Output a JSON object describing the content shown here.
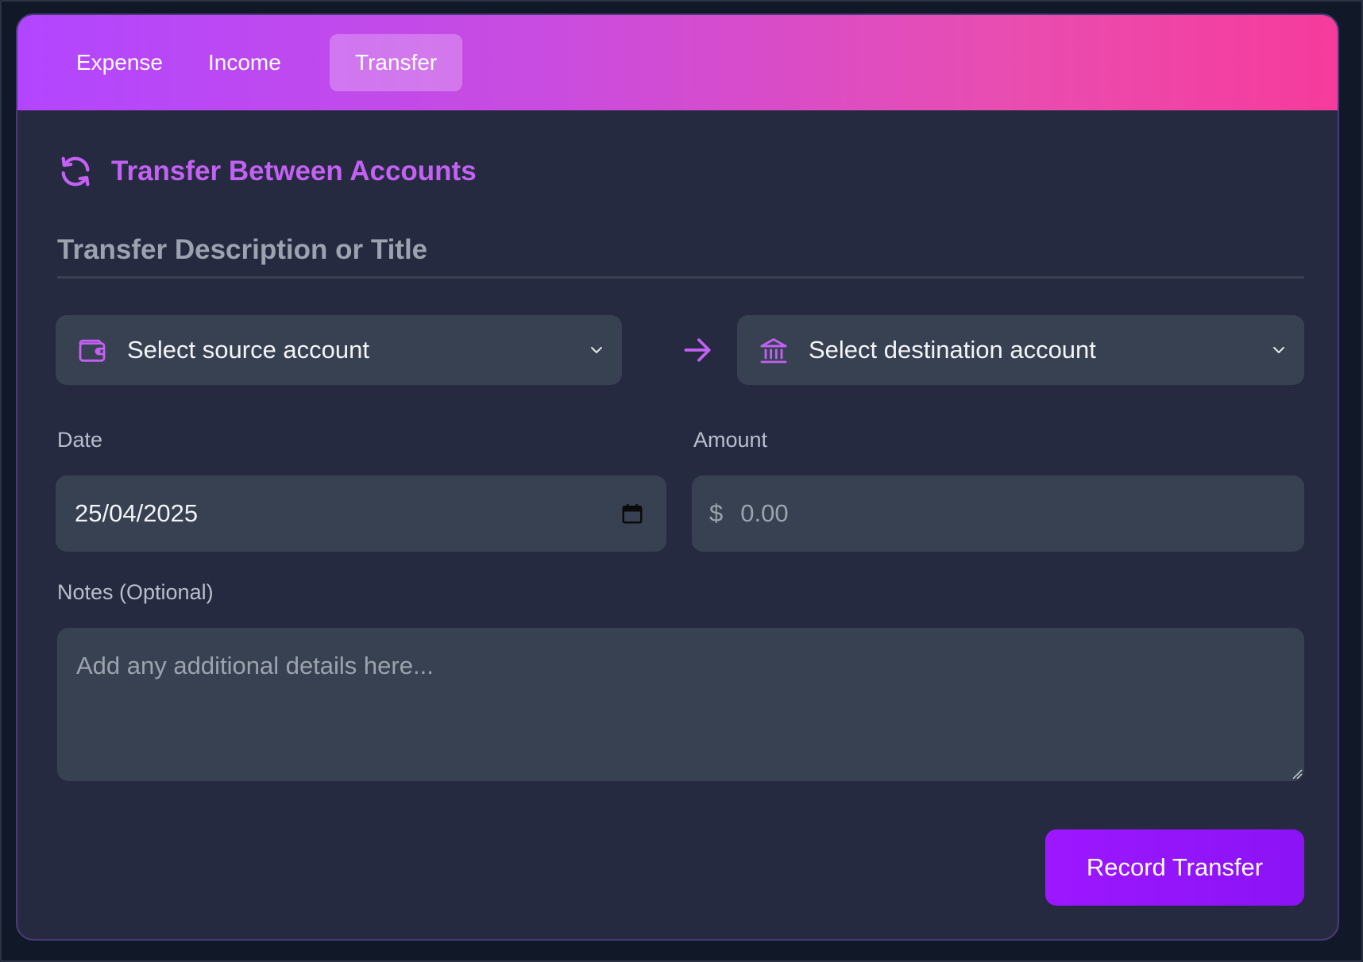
{
  "tabs": [
    {
      "label": "Expense",
      "active": false
    },
    {
      "label": "Income",
      "active": false
    },
    {
      "label": "Transfer",
      "active": true
    }
  ],
  "section": {
    "icon": "refresh-icon",
    "title": "Transfer Between Accounts"
  },
  "title_field": {
    "placeholder": "Transfer Description or Title",
    "value": ""
  },
  "source_account": {
    "icon": "wallet-icon",
    "label": "Select source account"
  },
  "transfer_arrow_icon": "arrow-right-icon",
  "destination_account": {
    "icon": "bank-icon",
    "label": "Select destination account"
  },
  "date_field": {
    "label": "Date",
    "value": "25/04/2025",
    "icon": "calendar-icon"
  },
  "amount_field": {
    "label": "Amount",
    "currency": "$",
    "placeholder": "0.00"
  },
  "notes_field": {
    "label": "Notes (Optional)",
    "placeholder": "Add any additional details here..."
  },
  "submit": {
    "label": "Record Transfer"
  },
  "colors": {
    "accent": "#c261f2",
    "button": "#9d17ff",
    "card_bg": "#262a41",
    "input_bg": "#374151",
    "gradient_start": "#b246ff",
    "gradient_end": "#f63b9c"
  }
}
